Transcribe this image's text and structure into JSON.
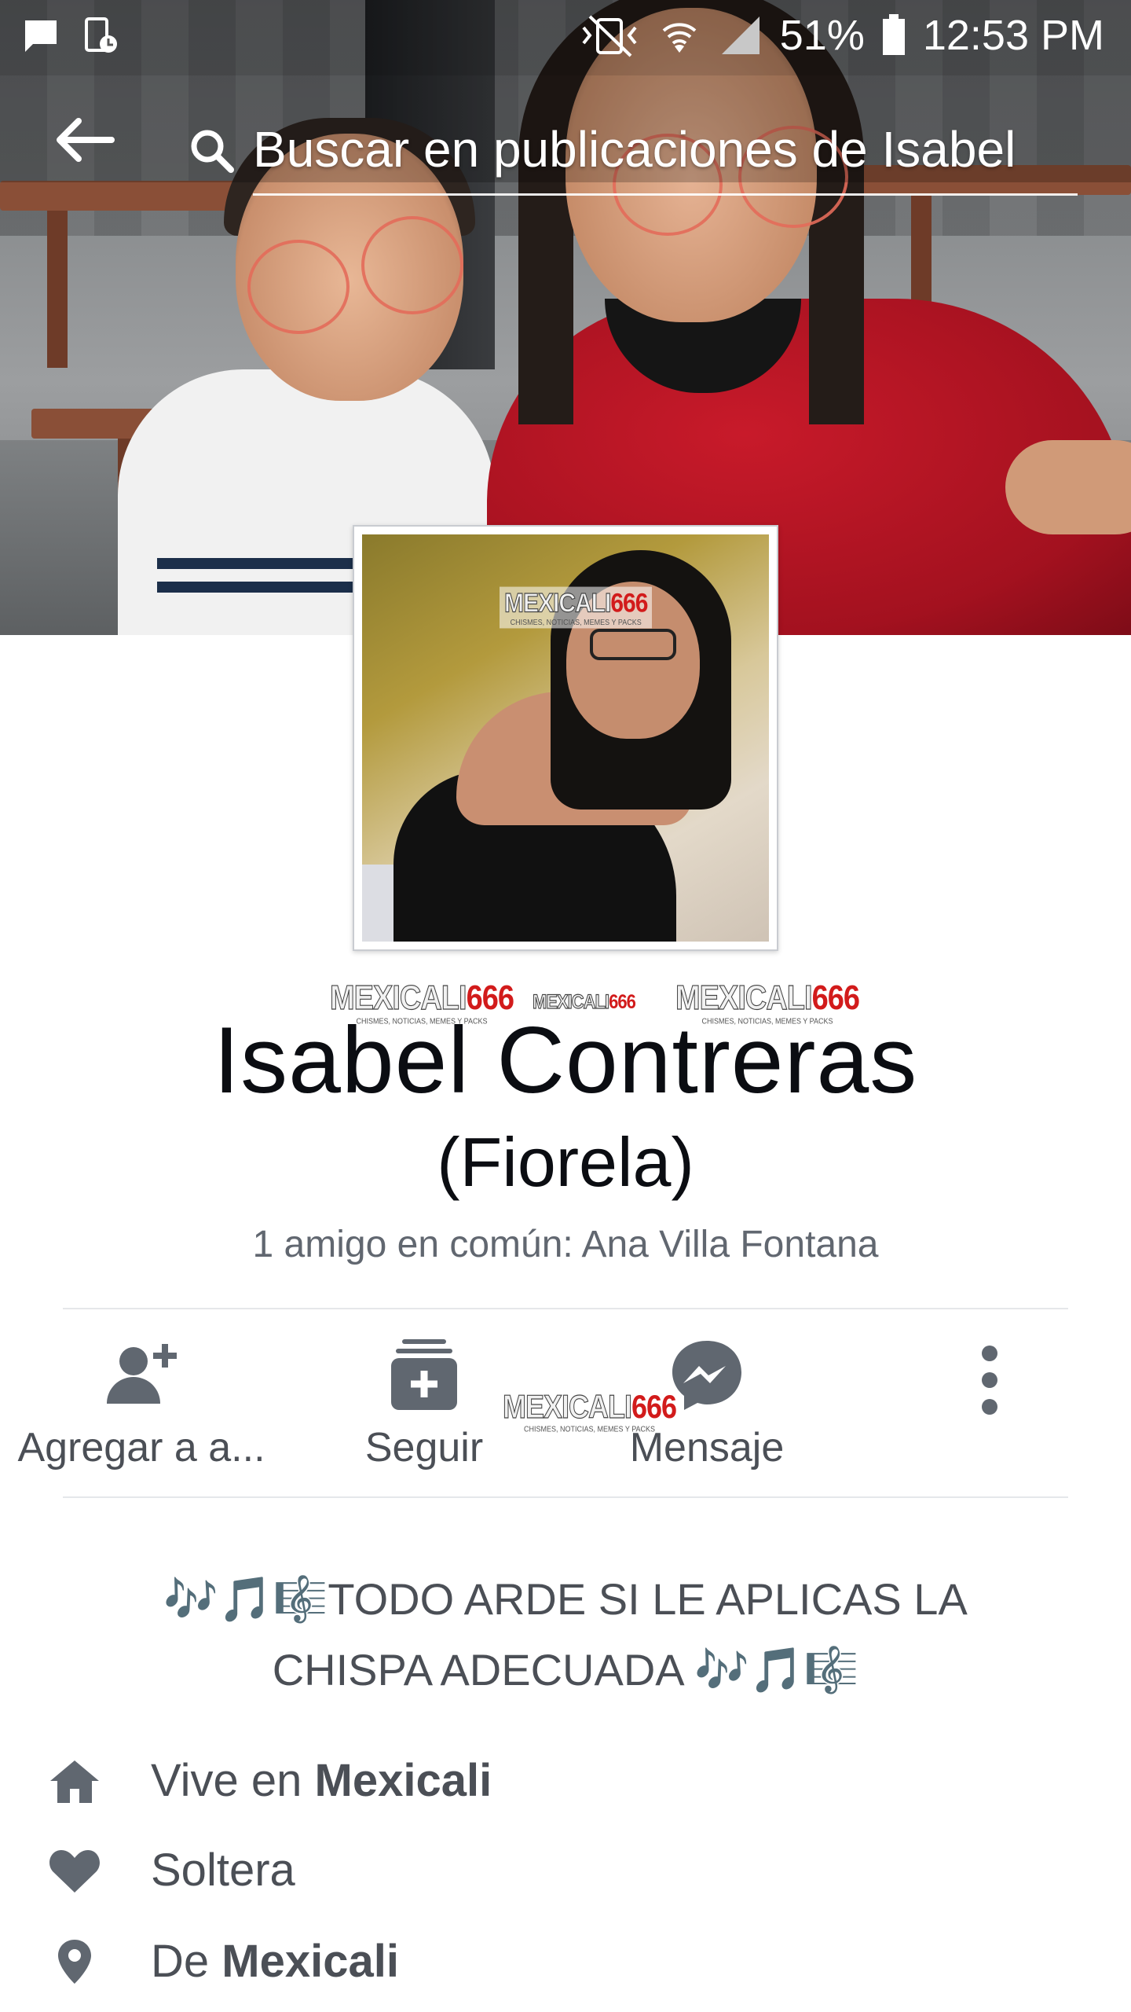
{
  "status_bar": {
    "battery_percent": "51%",
    "time": "12:53 PM",
    "icons": [
      "message-icon",
      "screen-record-icon",
      "vibrate-mute-icon",
      "wifi-icon",
      "signal-icon",
      "battery-icon"
    ]
  },
  "search": {
    "placeholder": "Buscar en publicaciones de Isabel"
  },
  "watermark": {
    "brand_a": "MEXICALI",
    "brand_b": "666",
    "tagline": "CHISMES, NOTICIAS, MEMES Y PACKS"
  },
  "profile": {
    "name": "Isabel Contreras",
    "alternate_name": "(Fiorela)",
    "mutual_friends": "1 amigo en común: Ana Villa Fontana"
  },
  "actions": [
    {
      "label": "Agregar a a...",
      "icon": "add-friend-icon"
    },
    {
      "label": "Seguir",
      "icon": "follow-icon"
    },
    {
      "label": "Mensaje",
      "icon": "messenger-icon"
    },
    {
      "label": "",
      "icon": "more-options-icon"
    }
  ],
  "bio": {
    "emoji_notes": "🎶🎵🎼",
    "line1": "TODO ARDE SI LE APLICAS LA",
    "line2": "CHISPA ADECUADA"
  },
  "details": [
    {
      "icon": "home-icon",
      "prefix": "Vive en ",
      "value": "Mexicali"
    },
    {
      "icon": "heart-icon",
      "prefix": "Soltera",
      "value": ""
    },
    {
      "icon": "location-pin-icon",
      "prefix": "De ",
      "value": "Mexicali"
    }
  ],
  "colors": {
    "icon_gray": "#606770",
    "text_gray": "#4b4f56",
    "name_black": "#0b0d12",
    "watermark_red": "#d21b1b"
  }
}
